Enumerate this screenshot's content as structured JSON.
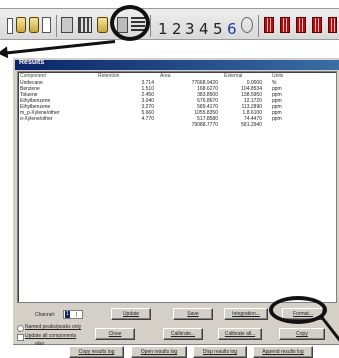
{
  "toolbar": {
    "numbers": [
      "1",
      "2",
      "3",
      "4",
      "5",
      "6"
    ]
  },
  "dialog": {
    "title": "Results"
  },
  "results": {
    "columns": [
      "Component",
      "Retention",
      "Area",
      "External",
      "Units"
    ],
    "rows": [
      [
        "Undecane",
        "3.714",
        "77668.9420",
        "0.0000",
        "%"
      ],
      [
        "Benzene",
        "1.510",
        "168.6270",
        "104.8534",
        "ppm"
      ],
      [
        "Toluene",
        "2.450",
        "383.8900",
        "138.5950",
        "ppm"
      ],
      [
        "Ethylbenzene",
        "3.040",
        "676.8670",
        "12.1720",
        "ppm"
      ],
      [
        "Ethylbenzene",
        "3.270",
        "589.4170",
        "113.2890",
        "ppm"
      ],
      [
        "m_p-Xylene/other",
        "5.660",
        "1055.8350",
        "1.8.6100",
        "ppm"
      ],
      [
        "o-Xylene/other",
        "4.770",
        "517.8580",
        "74.4470",
        "ppm"
      ],
      [
        "",
        "",
        "79088.7770",
        "581.2940",
        ""
      ]
    ]
  },
  "controls": {
    "channel_label": "Channel:",
    "channel_value": "1",
    "buttons": {
      "update": "Update",
      "save": "Save",
      "integration": "Integration...",
      "format": "Format...",
      "close": "Close",
      "calibrate": "Calibrate...",
      "calibrate_all": "Calibrate all...",
      "copy": "Copy",
      "copy_results_log": "Copy results log",
      "open_results_log": "Open results log",
      "display_results_log": "Disp results log",
      "append_results_log": "Append results log"
    },
    "checkboxes": {
      "named_peaks": "Named peaks/peaks only",
      "update_all": "Update all components",
      "also": "also"
    }
  },
  "colors": {
    "titlebar": "#0a246a",
    "dialog_face": "#d4d0c8",
    "annotation": "#111111"
  }
}
